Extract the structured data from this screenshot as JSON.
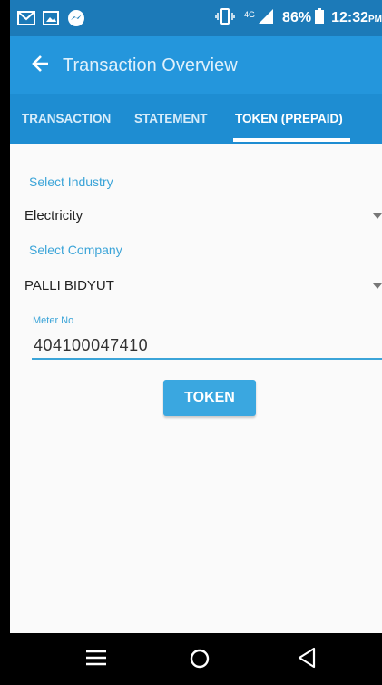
{
  "colors": {
    "status_bar": "#1c7ab8",
    "app_bar": "#2496dc",
    "tab_bar": "#1e8dd2",
    "accent": "#3ba4d8",
    "button": "#3aa7e0"
  },
  "status_bar": {
    "left_icons": [
      "gmail-icon",
      "gallery-icon",
      "messenger-icon"
    ],
    "network": "4G",
    "battery": "86%",
    "time": "12:32",
    "ampm": "PM"
  },
  "app_bar": {
    "title": "Transaction Overview"
  },
  "tabs": [
    {
      "label": "TRANSACTION",
      "active": false
    },
    {
      "label": "STATEMENT",
      "active": false
    },
    {
      "label": "TOKEN (PREPAID)",
      "active": true
    }
  ],
  "form": {
    "industry_label": "Select Industry",
    "industry_value": "Electricity",
    "company_label": "Select Company",
    "company_value": "PALLI BIDYUT",
    "meter_label": "Meter No",
    "meter_value": "404100047410",
    "submit_label": "TOKEN"
  },
  "nav_bar": {
    "icons": [
      "menu-icon",
      "home-icon",
      "back-icon"
    ]
  }
}
